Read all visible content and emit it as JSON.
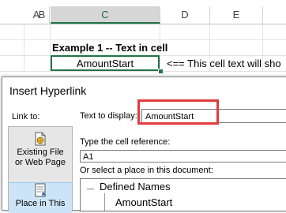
{
  "sheet": {
    "columns": [
      "A",
      "B",
      "C",
      "D",
      "E"
    ],
    "selected_column": "C",
    "example_title": "Example 1 -- Text in cell",
    "cell_value": "AmountStart",
    "note": "<== This cell text will sho"
  },
  "dialog": {
    "title": "Insert Hyperlink",
    "link_to_label": "Link to:",
    "link_to_items": [
      {
        "label_line1": "Existing File",
        "label_line2": "or Web Page",
        "icon": "globe-file-icon"
      },
      {
        "label_line1": "Place in This",
        "label_line2": "",
        "icon": "place-in-document-icon"
      }
    ],
    "text_to_display_label": "Text to display:",
    "text_to_display_value": "AmountStart",
    "cell_reference_label": "Type the cell reference:",
    "cell_reference_value": "A1",
    "place_label": "Or select a place in this document:",
    "tree": {
      "root": "Defined Names",
      "child": "AmountStart"
    }
  },
  "colors": {
    "excel_green": "#217346",
    "highlight_red": "#e03c3c",
    "selected_pane": "#cce4f7"
  }
}
